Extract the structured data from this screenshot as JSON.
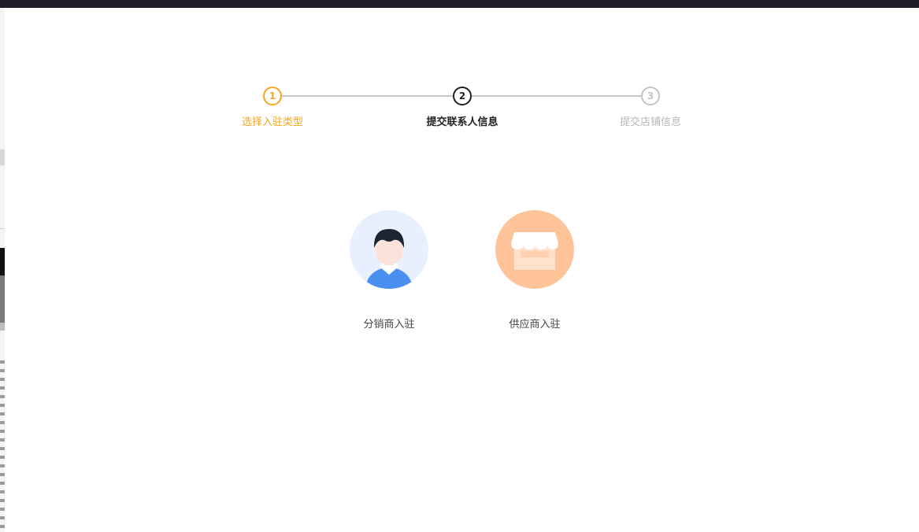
{
  "steps": [
    {
      "number": "1",
      "label": "选择入驻类型",
      "state": "active"
    },
    {
      "number": "2",
      "label": "提交联系人信息",
      "state": "current"
    },
    {
      "number": "3",
      "label": "提交店铺信息",
      "state": "pending"
    }
  ],
  "options": [
    {
      "label": "分销商入驻",
      "icon": "distributor-person-icon"
    },
    {
      "label": "供应商入驻",
      "icon": "supplier-store-icon"
    }
  ],
  "colors": {
    "active": "#f5a623",
    "current": "#222222",
    "pending": "#c4c4c8",
    "distributor_bg": "#e8efff",
    "supplier_bg": "#ffc39a"
  }
}
